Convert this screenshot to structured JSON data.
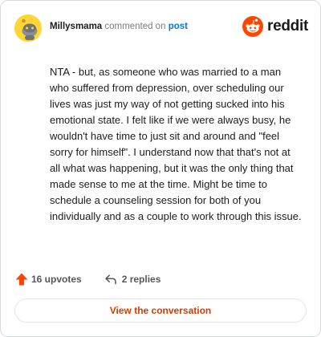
{
  "comment": {
    "username": "Millysmama",
    "action_text": "commented on",
    "post_link_text": "post",
    "body": "NTA - but, as someone who was married to a man who suffered from depression, over scheduling our lives was just my way of not getting sucked into his emotional state. I felt like if we were always busy, he wouldn't have time to just sit and around and \"feel sorry for himself\". I understand now that that's not at all what was happening, but it was the only thing that made sense to me at the time. Might be time to schedule a counseling session for both of you individually and as a couple to work through this issue."
  },
  "brand": {
    "wordmark": "reddit",
    "icon": "reddit-snoo-icon",
    "color": "#ff4500"
  },
  "stats": {
    "upvotes_label": "16 upvotes",
    "upvote_icon": "upvote-arrow-icon",
    "upvote_color": "#ff4500",
    "replies_label": "2 replies",
    "reply_icon": "reply-arrow-icon"
  },
  "cta": {
    "label": "View the conversation",
    "color": "#d93a00"
  },
  "colors": {
    "link": "#0079d3",
    "avatar_bg": "#ffd635"
  }
}
